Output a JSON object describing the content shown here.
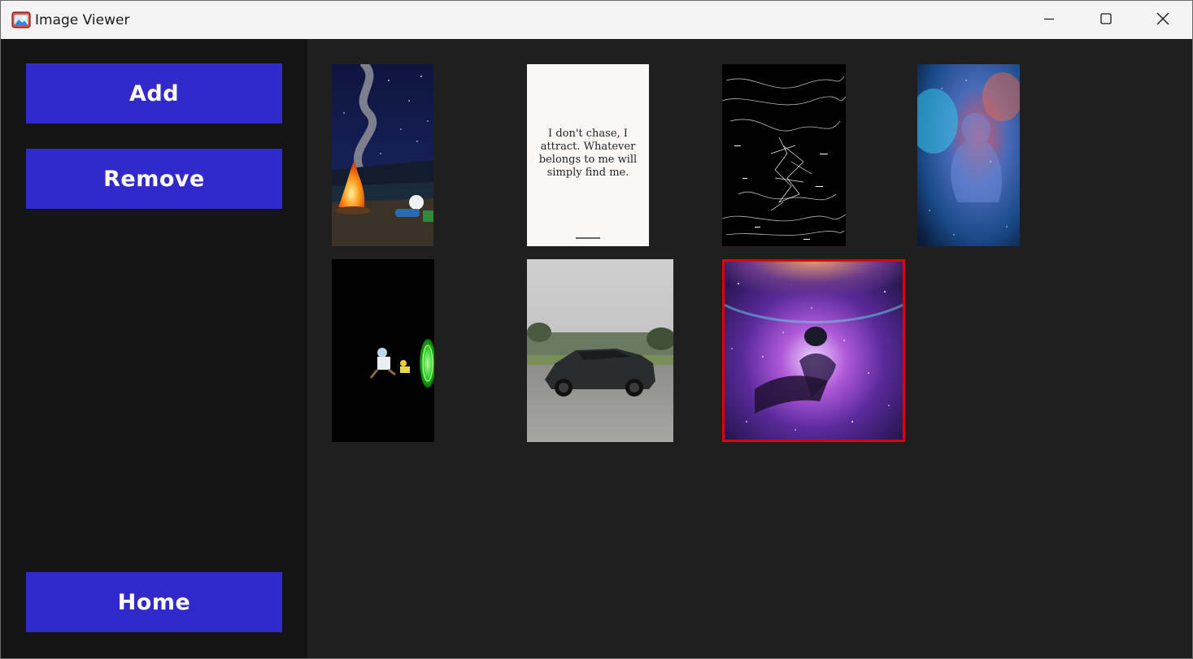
{
  "window": {
    "title": "Image Viewer",
    "icons": {
      "app": "image-viewer-app-icon",
      "minimize": "minimize-icon",
      "maximize": "maximize-icon",
      "close": "close-icon"
    }
  },
  "sidebar": {
    "add_label": "Add",
    "remove_label": "Remove",
    "home_label": "Home",
    "button_color": "#3129c9",
    "background": "#141414"
  },
  "gallery": {
    "background": "#1f1f1f",
    "selection_color": "#e00000",
    "images": [
      {
        "name": "campfire-night-cartoon"
      },
      {
        "name": "quote-card",
        "text": "I don't chase, I attract. Whatever belongs to me will simply find me."
      },
      {
        "name": "white-lines-abstract"
      },
      {
        "name": "cosmic-figure"
      },
      {
        "name": "portal-cartoon"
      },
      {
        "name": "black-suv-photo"
      },
      {
        "name": "purple-galaxy",
        "selected": true
      }
    ]
  }
}
